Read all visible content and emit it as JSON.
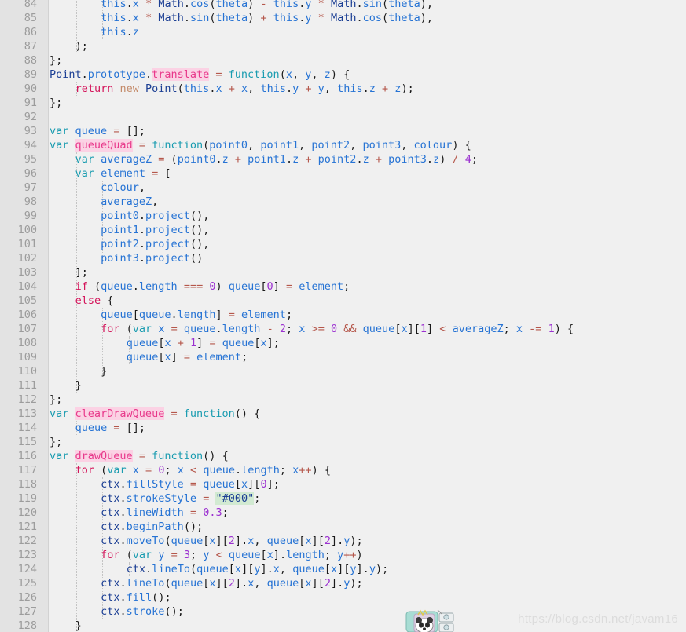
{
  "editor": {
    "language": "JavaScript",
    "background": "#f0f0f0",
    "gutter_background": "#e3e3e3",
    "line_number_color": "#9c9c9c",
    "first_line": 84,
    "last_line": 128
  },
  "watermark": {
    "text": "https://blog.csdn.net/javam16"
  },
  "sticker": {
    "name": "panda-in-box-sticker"
  },
  "lines": [
    {
      "n": "84",
      "text": "        this.x * Math.cos(theta) - this.y * Math.sin(theta),"
    },
    {
      "n": "85",
      "text": "        this.x * Math.sin(theta) + this.y * Math.cos(theta),"
    },
    {
      "n": "86",
      "text": "        this.z"
    },
    {
      "n": "87",
      "text": "    );"
    },
    {
      "n": "88",
      "text": "};"
    },
    {
      "n": "89",
      "text": "Point.prototype.translate = function(x, y, z) {"
    },
    {
      "n": "90",
      "text": "    return new Point(this.x + x, this.y + y, this.z + z);"
    },
    {
      "n": "91",
      "text": "};"
    },
    {
      "n": "92",
      "text": ""
    },
    {
      "n": "93",
      "text": "var queue = [];"
    },
    {
      "n": "94",
      "text": "var queueQuad = function(point0, point1, point2, point3, colour) {"
    },
    {
      "n": "95",
      "text": "    var averageZ = (point0.z + point1.z + point2.z + point3.z) / 4;"
    },
    {
      "n": "96",
      "text": "    var element = ["
    },
    {
      "n": "97",
      "text": "        colour,"
    },
    {
      "n": "98",
      "text": "        averageZ,"
    },
    {
      "n": "99",
      "text": "        point0.project(),"
    },
    {
      "n": "100",
      "text": "        point1.project(),"
    },
    {
      "n": "101",
      "text": "        point2.project(),"
    },
    {
      "n": "102",
      "text": "        point3.project()"
    },
    {
      "n": "103",
      "text": "    ];"
    },
    {
      "n": "104",
      "text": "    if (queue.length === 0) queue[0] = element;"
    },
    {
      "n": "105",
      "text": "    else {"
    },
    {
      "n": "106",
      "text": "        queue[queue.length] = element;"
    },
    {
      "n": "107",
      "text": "        for (var x = queue.length - 2; x >= 0 && queue[x][1] < averageZ; x -= 1) {"
    },
    {
      "n": "108",
      "text": "            queue[x + 1] = queue[x];"
    },
    {
      "n": "109",
      "text": "            queue[x] = element;"
    },
    {
      "n": "110",
      "text": "        }"
    },
    {
      "n": "111",
      "text": "    }"
    },
    {
      "n": "112",
      "text": "};"
    },
    {
      "n": "113",
      "text": "var clearDrawQueue = function() {"
    },
    {
      "n": "114",
      "text": "    queue = [];"
    },
    {
      "n": "115",
      "text": "};"
    },
    {
      "n": "116",
      "text": "var drawQueue = function() {"
    },
    {
      "n": "117",
      "text": "    for (var x = 0; x < queue.length; x++) {"
    },
    {
      "n": "118",
      "text": "        ctx.fillStyle = queue[x][0];"
    },
    {
      "n": "119",
      "text": "        ctx.strokeStyle = \"#000\";"
    },
    {
      "n": "120",
      "text": "        ctx.lineWidth = 0.3;"
    },
    {
      "n": "121",
      "text": "        ctx.beginPath();"
    },
    {
      "n": "122",
      "text": "        ctx.moveTo(queue[x][2].x, queue[x][2].y);"
    },
    {
      "n": "123",
      "text": "        for (var y = 3; y < queue[x].length; y++)"
    },
    {
      "n": "124",
      "text": "            ctx.lineTo(queue[x][y].x, queue[x][y].y);"
    },
    {
      "n": "125",
      "text": "        ctx.lineTo(queue[x][2].x, queue[x][2].y);"
    },
    {
      "n": "126",
      "text": "        ctx.fill();"
    },
    {
      "n": "127",
      "text": "        ctx.stroke();"
    },
    {
      "n": "128",
      "text": "    }"
    }
  ],
  "theme": {
    "keyword": "#1a9cb0",
    "control": "#d4145a",
    "identifier": "#2673d4",
    "object": "#1c3f94",
    "number": "#9b30d0",
    "operator": "#b5574b",
    "function_name_highlight_bg": "#fbd2e4",
    "function_name_fg": "#e8398b",
    "string_highlight_bg": "#d2ead2",
    "new_keyword": "#c48b6a"
  }
}
